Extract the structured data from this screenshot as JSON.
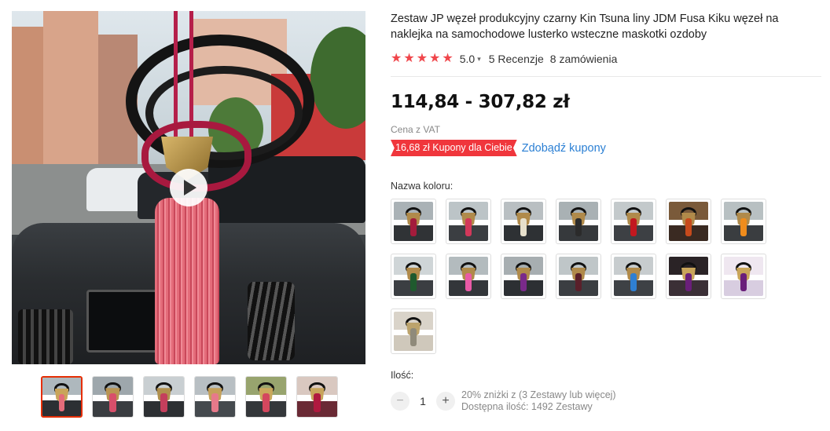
{
  "product": {
    "title": "Zestaw JP węzeł produkcyjny czarny Kin Tsuna liny JDM Fusa Kiku węzeł na naklejka na samochodowe lusterko wsteczne maskotki ozdoby",
    "rating": "5.0",
    "stars": 5,
    "reviews": "5 Recenzje",
    "orders": "8 zamówienia",
    "price": "114,84 - 307,82 zł",
    "vat": "Cena z VAT",
    "coupon_badge": "16,68 zł Kupony dla Ciebie",
    "coupon_link": "Zdobądź kupony",
    "color_label": "Nazwa koloru:",
    "quantity_label": "Ilość:",
    "quantity_value": "1",
    "discount_info": "20% zniżki z (3 Zestawy lub więcej)",
    "stock_info": "Dostępna ilość: 1492 Zestawy"
  },
  "icons": {
    "star": "star-icon",
    "chevron": "chevron-down-icon",
    "play": "play-icon",
    "minus": "minus-icon",
    "plus": "plus-icon"
  },
  "colors": {
    "accent_red": "#f0363c",
    "link_blue": "#2a7fd4",
    "active_border": "#e62e04"
  },
  "thumbnails": [
    {
      "tassel": "#e46c7a",
      "med": "#c9a55a",
      "sky": "#aeb8bd",
      "dash": "#2c2f33"
    },
    {
      "tassel": "#d84f6a",
      "med": "#b99452",
      "sky": "#9ea7ac",
      "dash": "#3a3d41"
    },
    {
      "tassel": "#c43f5c",
      "med": "#b0904e",
      "sky": "#c9cfd2",
      "dash": "#2d3033"
    },
    {
      "tassel": "#e7798a",
      "med": "#c4a05a",
      "sky": "#b8bfc3",
      "dash": "#454a4e"
    },
    {
      "tassel": "#d4475e",
      "med": "#caa85c",
      "sky": "#98a46e",
      "dash": "#34373a"
    },
    {
      "tassel": "#b0193f",
      "med": "#c7a45b",
      "sky": "#d9c8c0",
      "dash": "#6a2a35"
    }
  ],
  "swatches": [
    {
      "tassel": "#a31c3c",
      "med": "#b08a4a",
      "sky": "#aab2b6",
      "dash": "#303336"
    },
    {
      "tassel": "#d2385a",
      "med": "#b08a4a",
      "sky": "#bcc4c7",
      "dash": "#3b3e42"
    },
    {
      "tassel": "#e7e0cc",
      "med": "#b08a4a",
      "sky": "#b9bfc2",
      "dash": "#2e3134"
    },
    {
      "tassel": "#2b2b2b",
      "med": "#b08a4a",
      "sky": "#a9b1b4",
      "dash": "#36393c"
    },
    {
      "tassel": "#c2181f",
      "med": "#b08a4a",
      "sky": "#c3c9cb",
      "dash": "#3d4044"
    },
    {
      "tassel": "#c74a1c",
      "med": "#b08a4a",
      "sky": "#7a5a3a",
      "dash": "#3a2a22"
    },
    {
      "tassel": "#f08c1c",
      "med": "#b08a4a",
      "sky": "#b8c0c2",
      "dash": "#3a3d40"
    },
    {
      "tassel": "#1f5a2e",
      "med": "#b08a4a",
      "sky": "#cfd5d7",
      "dash": "#3b3e42"
    },
    {
      "tassel": "#e95aa6",
      "med": "#b08a4a",
      "sky": "#b3bbbe",
      "dash": "#33363a"
    },
    {
      "tassel": "#7a2a8a",
      "med": "#b08a4a",
      "sky": "#a7aeb1",
      "dash": "#2c2f33"
    },
    {
      "tassel": "#5a1f2a",
      "med": "#b08a4a",
      "sky": "#bfc6c8",
      "dash": "#3b3e42"
    },
    {
      "tassel": "#2f7fd1",
      "med": "#b08a4a",
      "sky": "#c7ccce",
      "dash": "#3e4145"
    },
    {
      "tassel": "#6a1f7a",
      "med": "#c9a55a",
      "sky": "#2a2326",
      "dash": "#3b2f36"
    },
    {
      "tassel": "#6a1f7a",
      "med": "#c9a55a",
      "sky": "#efe7f0",
      "dash": "#d8cde0"
    },
    {
      "tassel": "#8f8a7a",
      "med": "#bca36c",
      "sky": "#d9d3c9",
      "dash": "#cfc8bb"
    }
  ]
}
